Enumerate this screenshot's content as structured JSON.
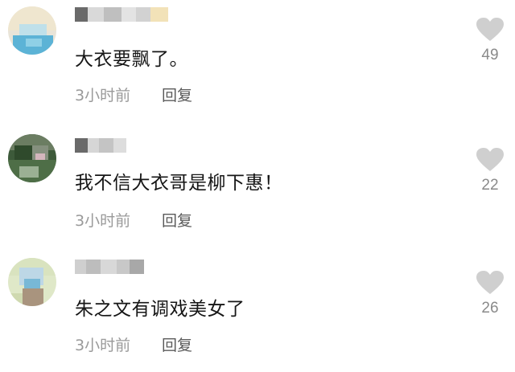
{
  "comments": [
    {
      "text": "大衣要飘了。",
      "time": "3小时前",
      "reply_label": "回复",
      "likes": "49"
    },
    {
      "text": "我不信大衣哥是柳下惠！",
      "time": "3小时前",
      "reply_label": "回复",
      "likes": "22"
    },
    {
      "text": "朱之文有调戏美女了",
      "time": "3小时前",
      "reply_label": "回复",
      "likes": "26"
    }
  ],
  "colors": {
    "heart": "#cfcfcf",
    "text": "#161616",
    "meta": "#9a9a9a",
    "reply": "#5a5a5a"
  },
  "icons": {
    "like": "heart-icon"
  }
}
